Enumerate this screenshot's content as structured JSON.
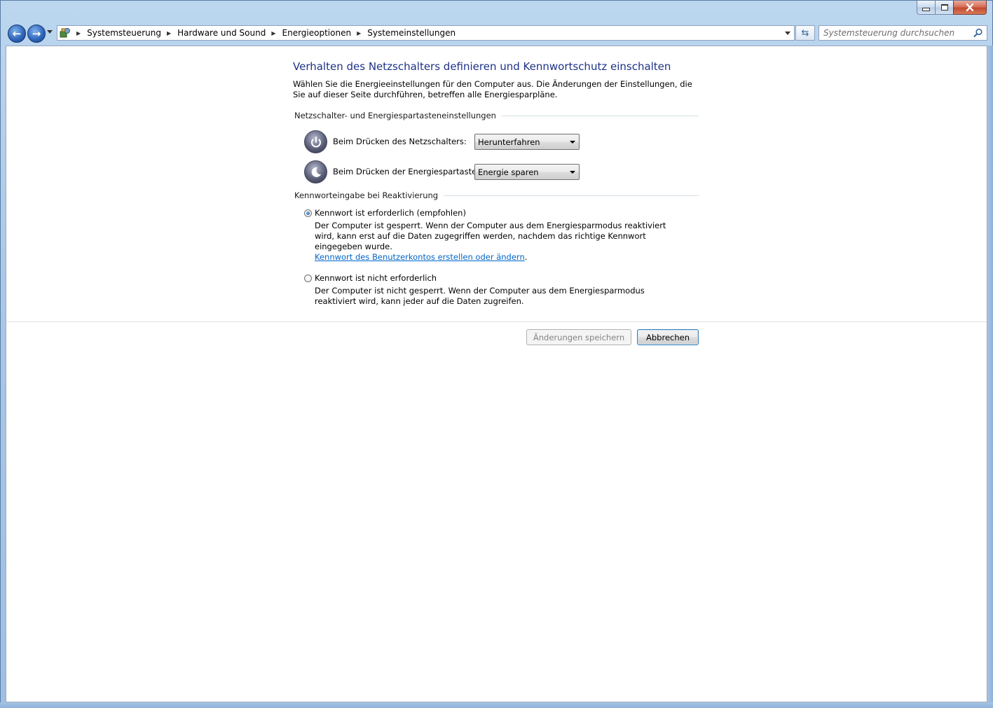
{
  "window": {
    "controls": {
      "minimize": "minimize-icon",
      "maximize": "restore-icon",
      "close": "close-icon"
    }
  },
  "nav": {
    "breadcrumbs": [
      "Systemsteuerung",
      "Hardware und Sound",
      "Energieoptionen",
      "Systemeinstellungen"
    ],
    "search_placeholder": "Systemsteuerung durchsuchen"
  },
  "page": {
    "title": "Verhalten des Netzschalters definieren und Kennwortschutz einschalten",
    "intro": "Wählen Sie die Energieeinstellungen für den Computer aus. Die Änderungen der Einstellungen, die Sie auf dieser Seite durchführen, betreffen alle Energiesparpläne.",
    "buttons_group": {
      "heading": "Netzschalter- und Energiespartasteneinstellungen",
      "power_button_label": "Beim Drücken des Netzschalters:",
      "power_button_value": "Herunterfahren",
      "sleep_button_label": "Beim Drücken der Energiespartaste:",
      "sleep_button_value": "Energie sparen"
    },
    "password_group": {
      "heading": "Kennworteingabe bei Reaktivierung",
      "option_required_label": "Kennwort ist erforderlich (empfohlen)",
      "option_required_desc": "Der Computer ist gesperrt. Wenn der Computer aus dem Energiesparmodus reaktiviert wird, kann erst auf die Daten zugegriffen werden, nachdem das richtige Kennwort eingegeben wurde.",
      "option_required_link": "Kennwort des Benutzerkontos erstellen oder ändern",
      "option_not_required_label": "Kennwort ist nicht erforderlich",
      "option_not_required_desc": "Der Computer ist nicht gesperrt. Wenn der Computer aus dem Energiesparmodus reaktiviert wird, kann jeder auf die Daten zugreifen."
    },
    "save_button": "Änderungen speichern",
    "cancel_button": "Abbrechen"
  }
}
